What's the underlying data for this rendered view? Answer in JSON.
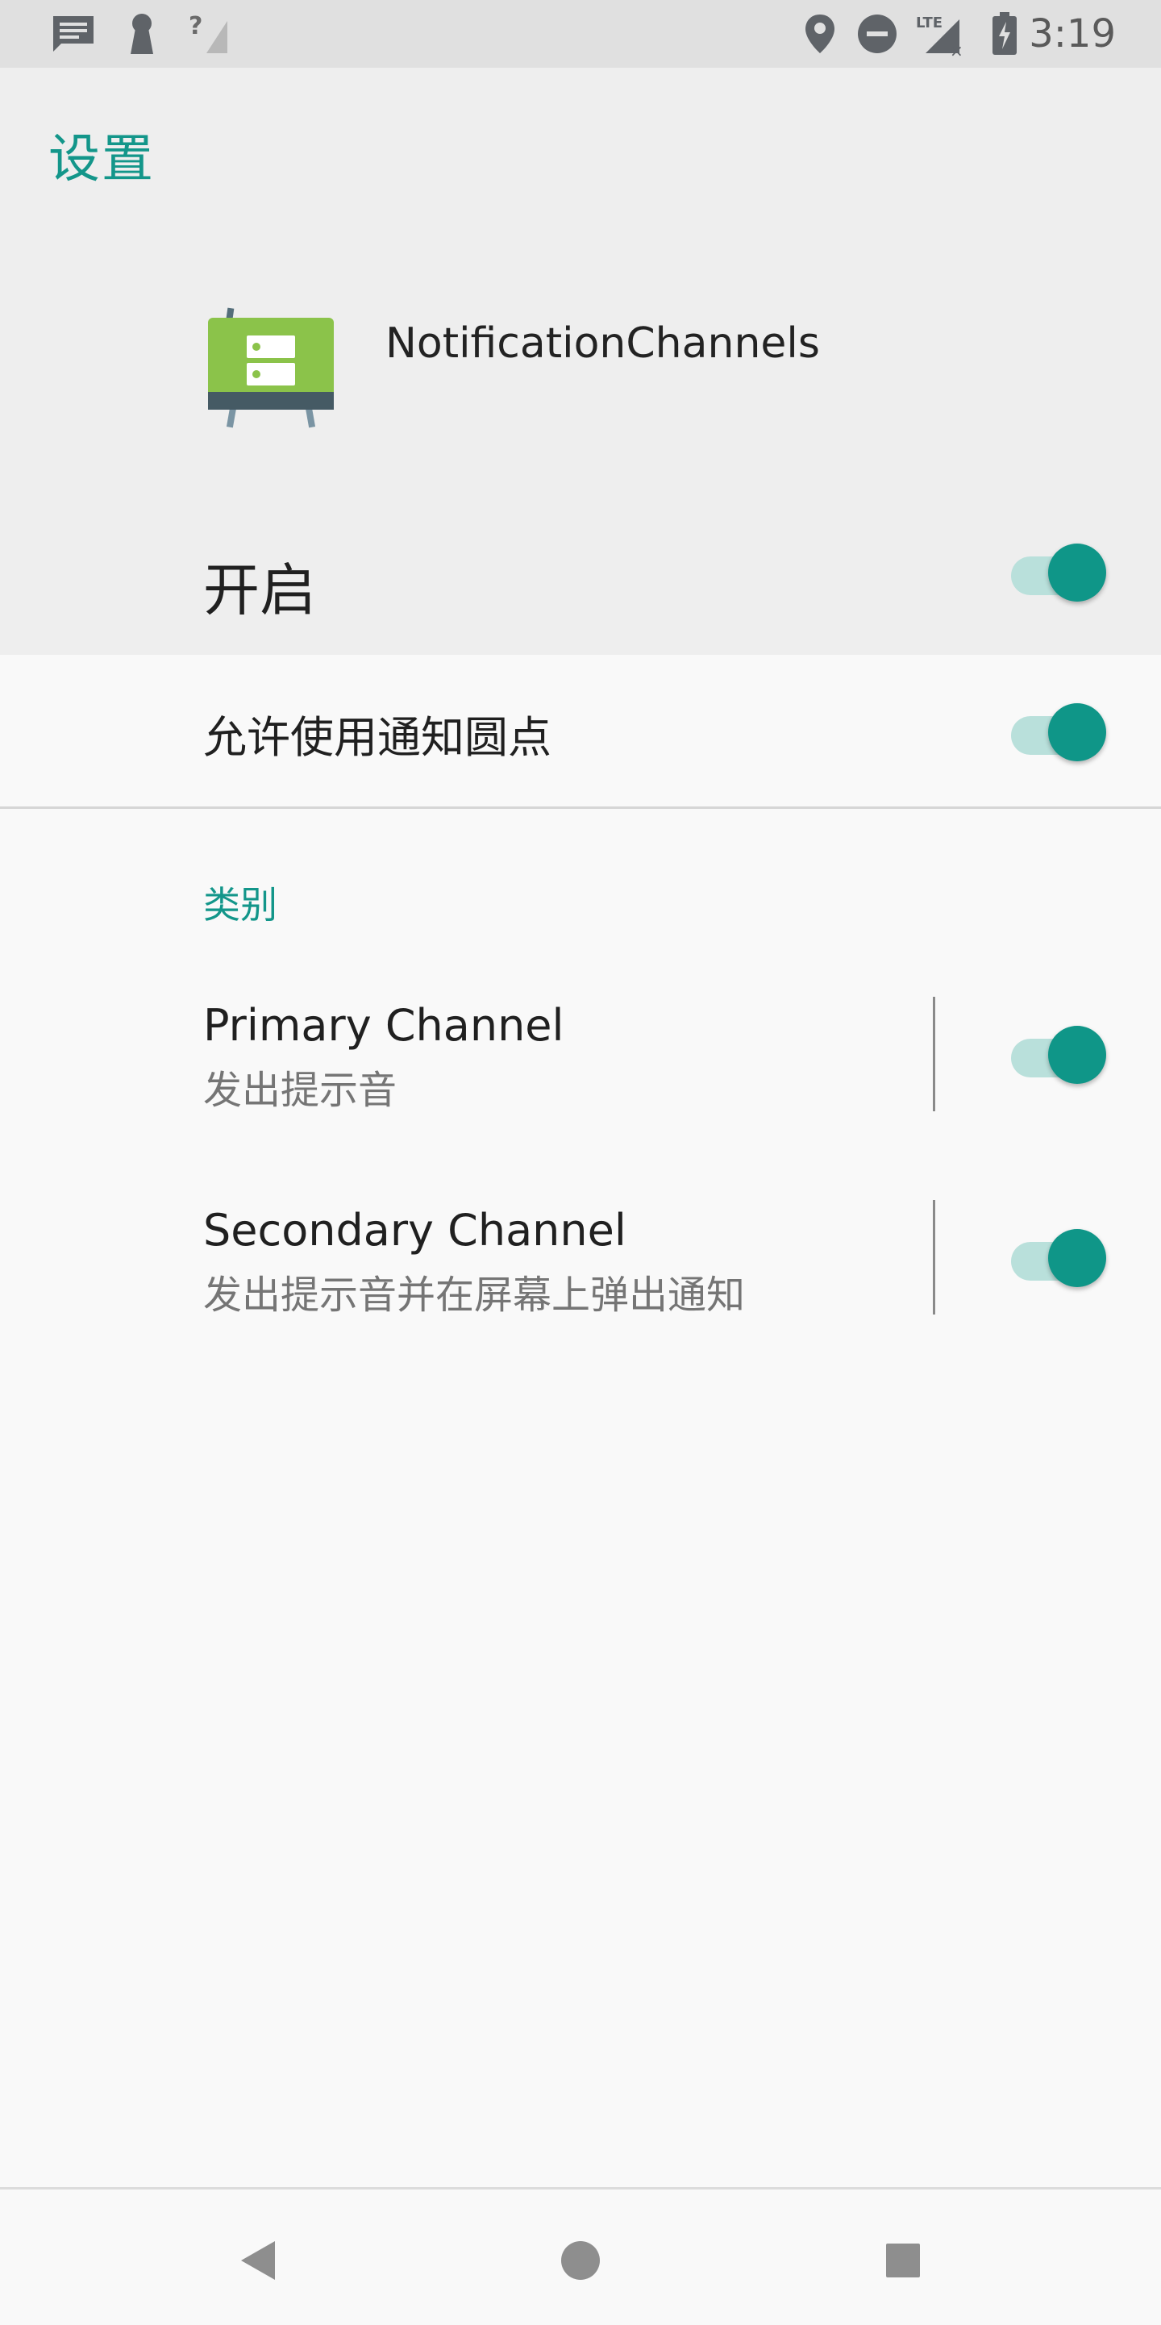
{
  "status_bar": {
    "time": "3:19",
    "left_icons": [
      "message-icon",
      "keyhole-icon",
      "no-signal-icon"
    ],
    "right_icons": [
      "location-icon",
      "do-not-disturb-icon",
      "lte-signal-icon",
      "battery-charging-icon"
    ],
    "lte_text": "LTE"
  },
  "header": {
    "title": "设置",
    "app_name": "NotificationChannels",
    "master_toggle": {
      "label": "开启",
      "on": true
    }
  },
  "settings": {
    "dots": {
      "label": "允许使用通知圆点",
      "on": true
    },
    "section_title": "类别",
    "channels": [
      {
        "title": "Primary Channel",
        "subtitle": "发出提示音",
        "on": true
      },
      {
        "title": "Secondary Channel",
        "subtitle": "发出提示音并在屏幕上弹出通知",
        "on": true
      }
    ]
  },
  "nav_bar": {
    "buttons": [
      "back-icon",
      "home-icon",
      "recents-icon"
    ]
  },
  "colors": {
    "accent": "#13968a",
    "switch_thumb": "#0f9688",
    "switch_track": "#b9e0db",
    "header_bg": "#eeeeee",
    "content_bg": "#f9f9f9"
  }
}
